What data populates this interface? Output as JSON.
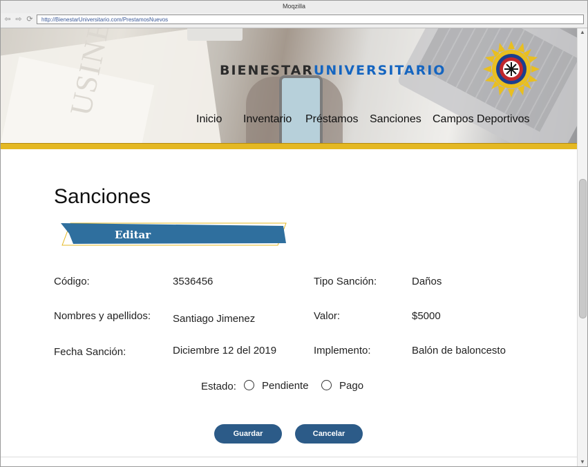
{
  "browser": {
    "title": "Moqzilla",
    "url": "http://BienestarUniversitario.com/PrestamosNuevos"
  },
  "banner": {
    "brand_part1": "BIENESTAR",
    "brand_part2": "UNIVERSITARIO",
    "menu": [
      "Inicio",
      "Inventario",
      "Préstamos",
      "Sanciones",
      "Campos Deportivos"
    ]
  },
  "page": {
    "heading": "Sanciones",
    "ribbon_label": "Editar"
  },
  "form": {
    "codigo_label": "Código:",
    "codigo_value": "3536456",
    "nombres_label": "Nombres y apellidos:",
    "nombres_value": "Santiago Jimenez",
    "fecha_label": "Fecha Sanción:",
    "fecha_value": "Diciembre 12 del 2019",
    "tipo_label": "Tipo Sanción:",
    "tipo_value": "Daños",
    "valor_label": "Valor:",
    "valor_value": "$5000",
    "implemento_label": "Implemento:",
    "implemento_value": "Balón de baloncesto",
    "estado_label": "Estado:",
    "estado_options": [
      "Pendiente",
      "Pago"
    ],
    "estado_selected": null
  },
  "buttons": {
    "save": "Guardar",
    "cancel": "Cancelar"
  },
  "colors": {
    "accent_gold": "#e4b823",
    "button_blue": "#2c5b88",
    "ribbon_blue": "#2f6f9e",
    "brand_blue": "#1565c0"
  }
}
